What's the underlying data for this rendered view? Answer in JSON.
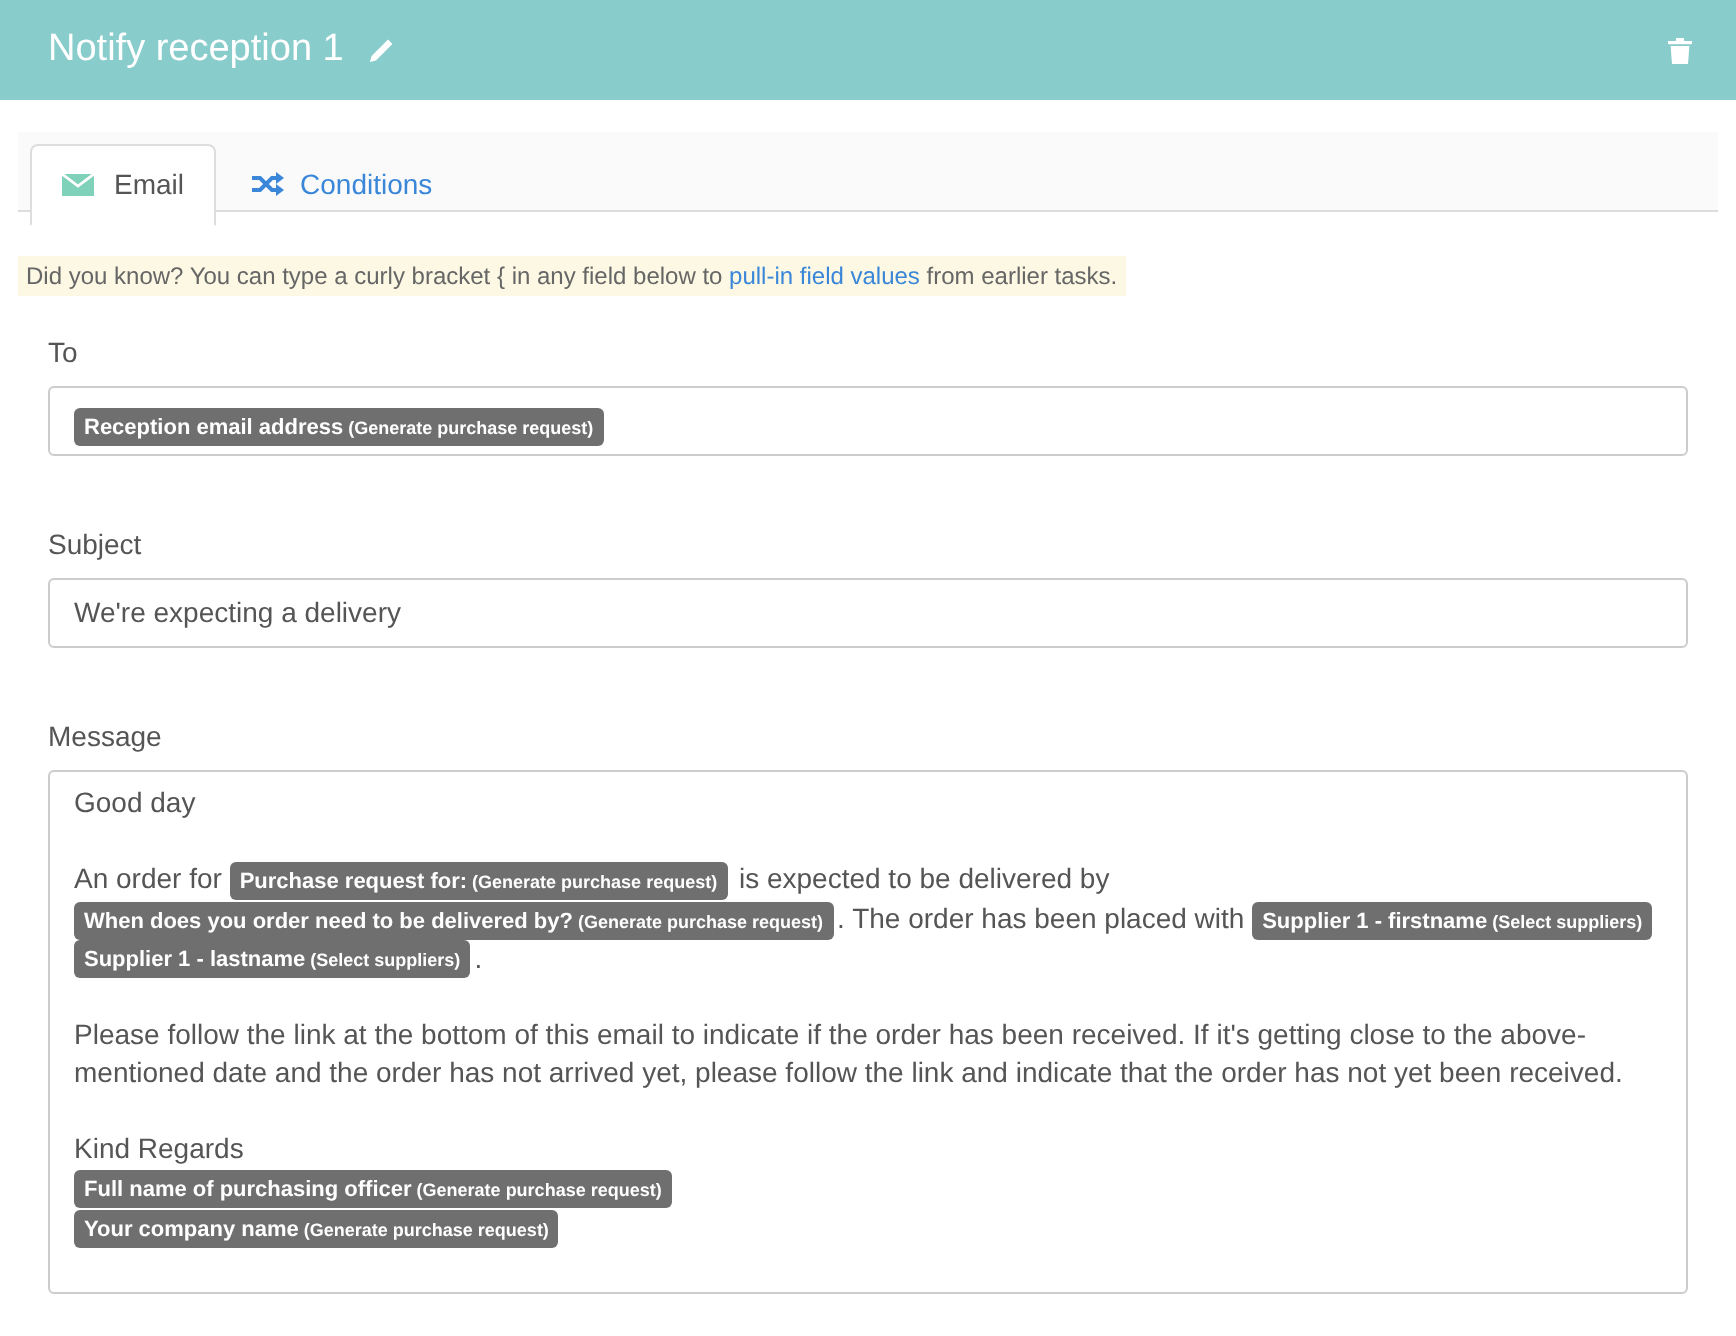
{
  "header": {
    "title": "Notify reception 1"
  },
  "tabs": [
    {
      "label": "Email",
      "selected": true
    },
    {
      "label": "Conditions",
      "selected": false
    }
  ],
  "hint": {
    "before": "Did you know? You can type a curly bracket { in any field below to ",
    "link": "pull-in field values",
    "after": " from earlier tasks."
  },
  "fields": [
    {
      "label": "To",
      "kind": "tokens",
      "tokens": [
        {
          "label": "Reception email address",
          "source": "(Generate purchase request)"
        }
      ]
    },
    {
      "label": "Subject",
      "kind": "text",
      "value": "We're expecting a delivery"
    },
    {
      "label": "Message",
      "kind": "message",
      "paragraphs": [
        [
          {
            "kind": "text",
            "text": "Good day"
          }
        ],
        [
          {
            "kind": "text",
            "text": "An order for "
          },
          {
            "kind": "token",
            "label": "Purchase request for:",
            "source": "(Generate purchase request)"
          },
          {
            "kind": "text",
            "text": " is expected to be delivered by "
          },
          {
            "kind": "token",
            "label": "When does you order need to be delivered by?",
            "source": "(Generate purchase request)"
          },
          {
            "kind": "text",
            "text": ". The order has been placed with "
          },
          {
            "kind": "token",
            "label": "Supplier 1 - firstname",
            "source": "(Select suppliers)"
          },
          {
            "kind": "token",
            "label": "Supplier 1 - lastname",
            "source": "(Select suppliers)"
          },
          {
            "kind": "text",
            "text": "."
          }
        ],
        [
          {
            "kind": "text",
            "text": "Please follow the link at the bottom of this email to indicate if the order has been received. If it's getting close to the above-mentioned date and the order has not arrived yet, please follow the link and indicate that the order has not yet been received."
          }
        ],
        [
          {
            "kind": "text",
            "text": "Kind Regards"
          },
          {
            "kind": "break"
          },
          {
            "kind": "token",
            "label": "Full name of purchasing officer",
            "source": "(Generate purchase request)"
          },
          {
            "kind": "break"
          },
          {
            "kind": "token",
            "label": "Your company name",
            "source": "(Generate purchase request)"
          }
        ]
      ]
    }
  ]
}
